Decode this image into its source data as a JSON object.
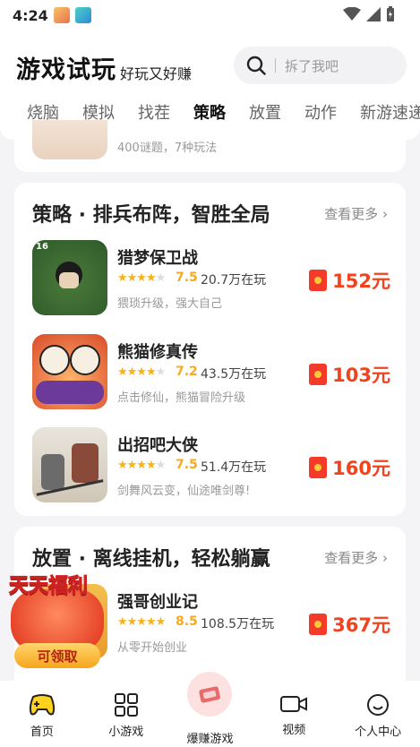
{
  "status_bar": {
    "time": "4:24"
  },
  "header": {
    "title": "游戏试玩",
    "subtitle": "好玩又好赚",
    "search_placeholder": "拆了我吧"
  },
  "tabs": [
    "烧脑",
    "模拟",
    "找茬",
    "策略",
    "放置",
    "动作",
    "新游速递"
  ],
  "active_tab": "策略",
  "partial_card": {
    "subtitle": "400谜题，7种玩法"
  },
  "section_strategy": {
    "title": "策略 · 排兵布阵，智胜全局",
    "more": "查看更多",
    "games": [
      {
        "name": "猎梦保卫战",
        "rating": "7.5",
        "players": "20.7万在玩",
        "desc": "猥琐升级，强大自己",
        "reward": "152元",
        "icon_badge": "16"
      },
      {
        "name": "熊猫修真传",
        "rating": "7.2",
        "players": "43.5万在玩",
        "desc": "点击修仙，熊猫冒险升级",
        "reward": "103元"
      },
      {
        "name": "出招吧大侠",
        "rating": "7.5",
        "players": "51.4万在玩",
        "desc": "剑舞风云变，仙途唯剑尊!",
        "reward": "160元"
      }
    ]
  },
  "section_idle": {
    "title": "放置 · 离线挂机，轻松躺赢",
    "more": "查看更多",
    "games": [
      {
        "name": "强哥创业记",
        "rating": "8.5",
        "players": "108.5万在玩",
        "desc": "从零开始创业",
        "reward": "367元"
      }
    ]
  },
  "welfare": {
    "title": "天天福利",
    "button": "可领取"
  },
  "bottom_nav": [
    "首页",
    "小游戏",
    "爆赚游戏",
    "视频",
    "个人中心"
  ],
  "colors": {
    "accent_yellow": "#ffd21f",
    "reward_red": "#f2421e",
    "star": "#f7b21b"
  }
}
